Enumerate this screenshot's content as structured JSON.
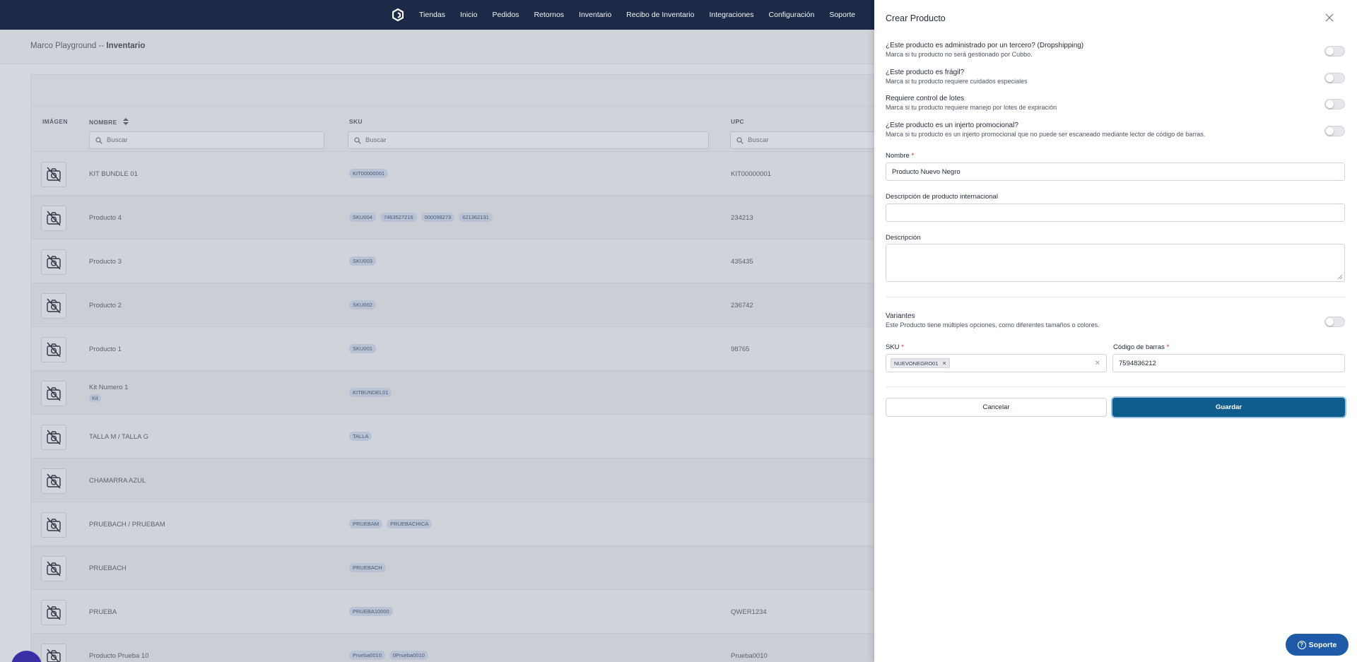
{
  "nav": {
    "links": [
      "Tiendas",
      "Inicio",
      "Pedidos",
      "Retornos",
      "Inventario",
      "Recibo de Inventario",
      "Integraciones",
      "Configuración",
      "Soporte"
    ]
  },
  "page": {
    "breadcrumb_store": "Marco Playground",
    "breadcrumb_sep": "--",
    "breadcrumb_section": "Inventario",
    "columns": {
      "image": "IMÁGEN",
      "name": "NOMBRE",
      "sku": "SKU",
      "upc": "UPC"
    },
    "filter_placeholder": "Buscar",
    "rows": [
      {
        "name": "KIT BUNDLE 01",
        "kit": "",
        "skus": [
          "KIT00000001"
        ],
        "upc": "KIT00000001"
      },
      {
        "name": "Producto 4",
        "kit": "",
        "skus": [
          "SKU004",
          "7463527216",
          "000098273",
          "621362131"
        ],
        "upc": "234213"
      },
      {
        "name": "Producto 3",
        "kit": "",
        "skus": [
          "SKU003"
        ],
        "upc": "435435"
      },
      {
        "name": "Producto 2",
        "kit": "",
        "skus": [
          "SKU002"
        ],
        "upc": "236742"
      },
      {
        "name": "Producto 1",
        "kit": "",
        "skus": [
          "SKU001"
        ],
        "upc": "98765"
      },
      {
        "name": "Kit Numero 1",
        "kit": "Kit",
        "skus": [
          "KITBUNDEL01"
        ],
        "upc": ""
      },
      {
        "name": "TALLA M / TALLA G",
        "kit": "",
        "skus": [
          "TALLA"
        ],
        "upc": ""
      },
      {
        "name": "CHAMARRA AZUL",
        "kit": "",
        "skus": [],
        "upc": ""
      },
      {
        "name": "PRUEBACH / PRUEBAM",
        "kit": "",
        "skus": [
          "PRUEBAM",
          "PRUEBACHICA"
        ],
        "upc": ""
      },
      {
        "name": "PRUEBACH",
        "kit": "",
        "skus": [
          "PRUEBACH"
        ],
        "upc": ""
      },
      {
        "name": "PRUEBA",
        "kit": "",
        "skus": [
          "PRUEBA10000"
        ],
        "upc": "QWER1234"
      },
      {
        "name": "Producto Prueba 10",
        "kit": "",
        "skus": [
          "Prueba0010",
          "0Prueba0010"
        ],
        "upc": "Prueba0010"
      }
    ]
  },
  "panel": {
    "title": "Crear Producto",
    "toggles": [
      {
        "title": "¿Este producto es administrado por un tercero? (Dropshipping)",
        "desc": "Marca si tu producto no será gestionado por Cubbo.",
        "on": false
      },
      {
        "title": "¿Este producto es frágil?",
        "desc": "Marca si tu producto requiere cuidados especiales",
        "on": false
      },
      {
        "title": "Requiere control de lotes",
        "desc": "Marca si tu producto requiere manejo por lotes de expiración",
        "on": false
      },
      {
        "title": "¿Este producto es un injerto promocional?",
        "desc": "Marca si tu producto es un injerto promocional que no puede ser escaneado mediante lector de código de barras.",
        "on": false
      }
    ],
    "name_label": "Nombre",
    "name_value": "Producto Nuevo Negro",
    "intl_desc_label": "Descripción de producto internacional",
    "intl_desc_value": "",
    "desc_label": "Descripción",
    "desc_value": "",
    "variants_title": "Variantes",
    "variants_desc": "Este Producto tiene múltiples opciones, como diferentes tamaños o colores.",
    "variants_on": false,
    "sku_label": "SKU",
    "sku_chips": [
      "NUEVONEGRO01"
    ],
    "barcode_label": "Código de barras",
    "barcode_value": "7594836212",
    "required_mark": "*",
    "cancel_label": "Cancelar",
    "save_label": "Guardar"
  },
  "support_button": "Soporte",
  "colors": {
    "nav_bg": "#1c2a47",
    "primary": "#0f5c8f",
    "support": "#1e5aa8",
    "chat": "#3b2fa6"
  }
}
